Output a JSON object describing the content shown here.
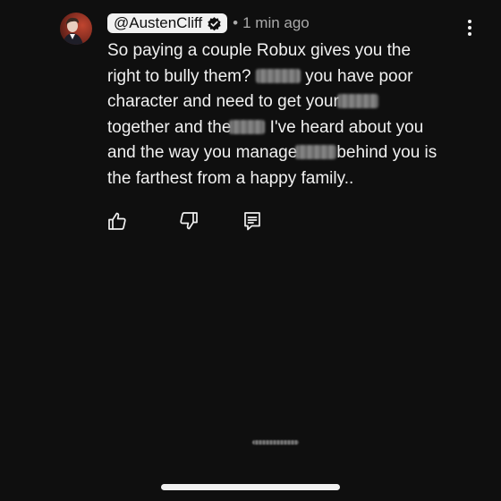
{
  "comment": {
    "handle": "@AustenCliff",
    "separator": "•",
    "timestamp": "1 min ago",
    "text": {
      "line1": "So paying a couple Robux gives you the",
      "line2_a": "right to bully them?",
      "line2_b": "you have poor",
      "line3_a": "character and need to get your",
      "line4_a": "together and the",
      "line4_b": "I've heard about you",
      "line5_a": "and the way you manage",
      "line5_b": "behind you is",
      "line6": "the farthest from a happy family.."
    },
    "icons": {
      "avatar": "user-avatar",
      "verified": "verified-check-icon",
      "more": "more-vertical-icon",
      "like": "thumbs-up-icon",
      "dislike": "thumbs-down-icon",
      "reply": "reply-comment-icon"
    }
  },
  "colors": {
    "background": "#0f0f0f",
    "text": "#f1f1f1",
    "secondary_text": "#aaaaaa",
    "handle_pill": "#f1f1f1"
  }
}
